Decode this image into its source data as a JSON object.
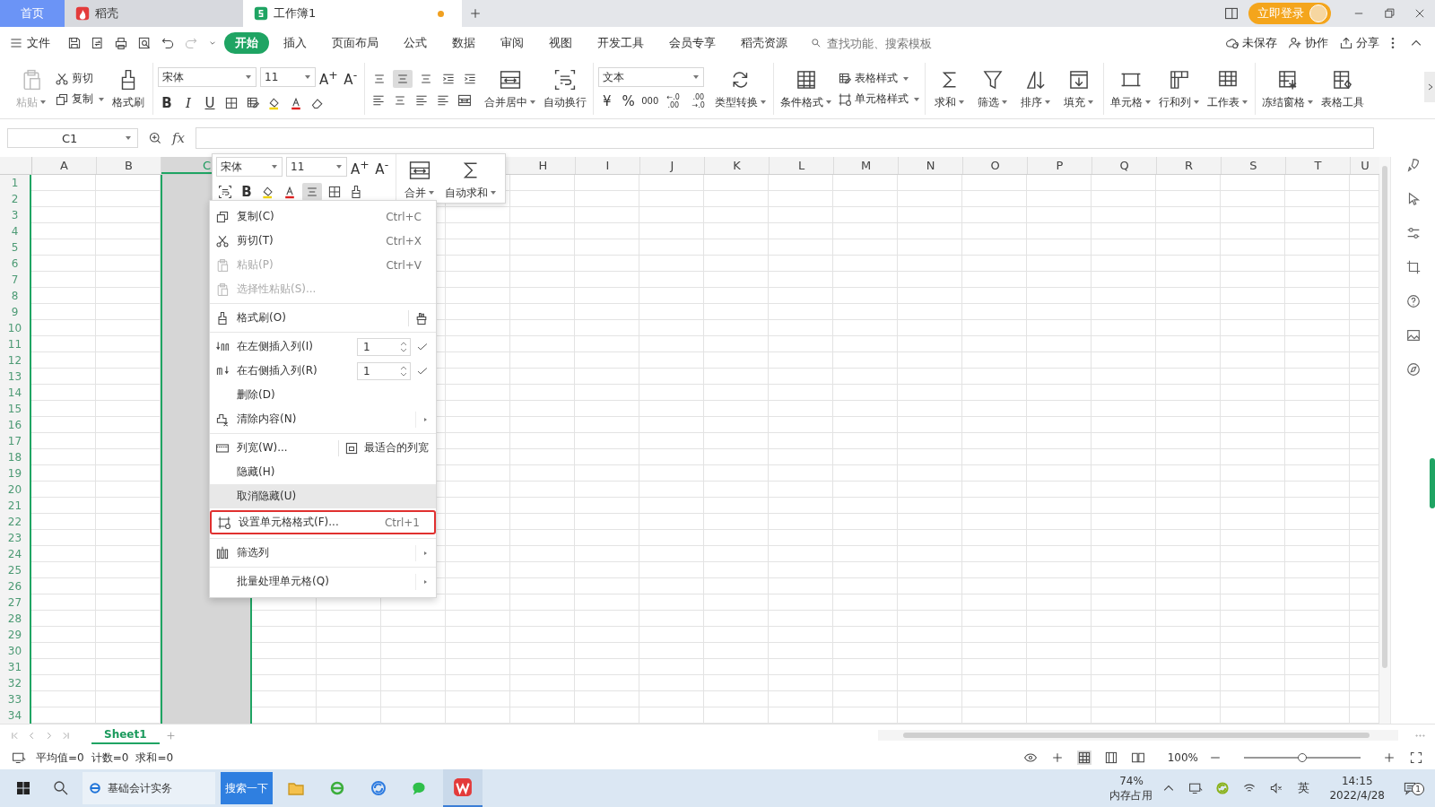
{
  "title_tabs": [
    {
      "label": "首页",
      "kind": "home",
      "selected": false,
      "modified": false
    },
    {
      "label": "稻壳",
      "kind": "docer",
      "selected": false,
      "modified": false
    },
    {
      "label": "工作簿1",
      "kind": "sheet",
      "selected": true,
      "modified": true
    }
  ],
  "login": "立即登录",
  "file_menu": "文件",
  "menu_tabs": [
    {
      "label": "开始",
      "selected": true
    },
    {
      "label": "插入",
      "selected": false
    },
    {
      "label": "页面布局",
      "selected": false
    },
    {
      "label": "公式",
      "selected": false
    },
    {
      "label": "数据",
      "selected": false
    },
    {
      "label": "审阅",
      "selected": false
    },
    {
      "label": "视图",
      "selected": false
    },
    {
      "label": "开发工具",
      "selected": false
    },
    {
      "label": "会员专享",
      "selected": false
    },
    {
      "label": "稻壳资源",
      "selected": false
    }
  ],
  "search": {
    "placeholder": "查找功能、搜索模板"
  },
  "unsaved": "未保存",
  "collaborate": "协作",
  "share": "分享",
  "ribbon": {
    "paste": {
      "label": "粘贴",
      "disabled": true
    },
    "cut": "剪切",
    "copy": "复制",
    "format_painter": "格式刷",
    "font_family": "宋体",
    "font_size": "11",
    "grow": "A$^{+}$",
    "shrink": "A$^{-}$",
    "bold": "B",
    "italic": "I",
    "underline": "U",
    "vertical_align": [
      {
        "selected": false
      },
      {
        "selected": true
      },
      {
        "selected": false
      }
    ],
    "merge": "合并居中",
    "wrap": "自动换行",
    "number_format": "文本",
    "currency": "¥",
    "percent": "%",
    "thousands": "000",
    "add_decimal": "←.0 .00",
    "remove_decimal": ".00 →.0",
    "convert": "类型转换",
    "conditional": "条件格式",
    "table_style": "表格样式",
    "cell_style": "单元格样式",
    "sum": "求和",
    "filter": "筛选",
    "sort": "排序",
    "fill": "填充",
    "cells": "单元格",
    "rows_cols": "行和列",
    "worksheet": "工作表",
    "freeze": "冻结窗格",
    "table_tools": "表格工具"
  },
  "name_box": "C1",
  "fx": "fx",
  "columns": [
    {
      "label": "A",
      "selected": false
    },
    {
      "label": "B",
      "selected": false
    },
    {
      "label": "C",
      "selected": true
    },
    {
      "label": "H",
      "selected": false
    },
    {
      "label": "I",
      "selected": false
    },
    {
      "label": "J",
      "selected": false
    },
    {
      "label": "K",
      "selected": false
    },
    {
      "label": "L",
      "selected": false
    },
    {
      "label": "M",
      "selected": false
    },
    {
      "label": "N",
      "selected": false
    },
    {
      "label": "O",
      "selected": false
    },
    {
      "label": "P",
      "selected": false
    },
    {
      "label": "Q",
      "selected": false
    },
    {
      "label": "R",
      "selected": false
    },
    {
      "label": "S",
      "selected": false
    },
    {
      "label": "T",
      "selected": false
    },
    {
      "label": "U",
      "selected": false
    }
  ],
  "rows": [
    "1",
    "2",
    "3",
    "4",
    "5",
    "6",
    "7",
    "8",
    "9",
    "10",
    "11",
    "12",
    "13",
    "14",
    "15",
    "16",
    "17",
    "18",
    "19",
    "20",
    "21",
    "22",
    "23",
    "24",
    "25",
    "26",
    "27",
    "28",
    "29",
    "30",
    "31",
    "32",
    "33",
    "34"
  ],
  "mini_toolbar": {
    "font": "宋体",
    "size": "11",
    "grow": "A$^{+}$",
    "shrink": "A$^{-}$",
    "merge": "合并",
    "autosum": "自动求和",
    "bold": "B",
    "align_active": true
  },
  "context_menu": [
    [
      {
        "kind": "plain",
        "label": "复制(C)",
        "shortcut": "Ctrl+C",
        "disabled": false,
        "submenu": false,
        "selected": false,
        "outlined": false
      },
      {
        "kind": "plain",
        "label": "剪切(T)",
        "shortcut": "Ctrl+X",
        "disabled": false,
        "submenu": false,
        "selected": false,
        "outlined": false
      },
      {
        "kind": "plain",
        "label": "粘贴(P)",
        "shortcut": "Ctrl+V",
        "disabled": true,
        "submenu": false,
        "selected": false,
        "outlined": false
      },
      {
        "kind": "plain",
        "label": "选择性粘贴(S)...",
        "disabled": true,
        "submenu": false,
        "selected": false,
        "outlined": false
      }
    ],
    [
      {
        "kind": "painter",
        "label": "格式刷(O)",
        "disabled": false,
        "submenu": false,
        "selected": false,
        "outlined": false
      }
    ],
    [
      {
        "kind": "spinner",
        "label": "在左侧插入列(I)",
        "value": "1",
        "disabled": false,
        "submenu": false,
        "selected": false,
        "outlined": false
      },
      {
        "kind": "spinner",
        "label": "在右侧插入列(R)",
        "value": "1",
        "disabled": false,
        "submenu": false,
        "selected": false,
        "outlined": false
      },
      {
        "kind": "plain",
        "label": "删除(D)",
        "disabled": false,
        "submenu": false,
        "selected": false,
        "outlined": false
      },
      {
        "kind": "plain",
        "label": "清除内容(N)",
        "disabled": false,
        "submenu": true,
        "selected": false,
        "outlined": false
      }
    ],
    [
      {
        "kind": "split",
        "label": "列宽(W)...",
        "aside": "最适合的列宽",
        "disabled": false,
        "submenu": false,
        "selected": false,
        "outlined": false
      },
      {
        "kind": "plain",
        "label": "隐藏(H)",
        "disabled": false,
        "submenu": false,
        "selected": false,
        "outlined": false
      },
      {
        "kind": "plain",
        "label": "取消隐藏(U)",
        "disabled": false,
        "submenu": false,
        "selected": true,
        "outlined": false
      },
      {
        "kind": "plain",
        "label": "设置单元格格式(F)...",
        "shortcut": "Ctrl+1",
        "disabled": false,
        "submenu": false,
        "selected": false,
        "outlined": true
      }
    ],
    [
      {
        "kind": "plain",
        "label": "筛选列",
        "disabled": false,
        "submenu": true,
        "selected": false,
        "outlined": false
      }
    ],
    [
      {
        "kind": "plain",
        "label": "批量处理单元格(Q)",
        "disabled": false,
        "submenu": true,
        "selected": false,
        "outlined": false
      }
    ]
  ],
  "sheet_tabs": [
    {
      "label": "Sheet1",
      "selected": true
    }
  ],
  "status": [
    "平均值=0",
    "计数=0",
    "求和=0"
  ],
  "zoom": {
    "reading": "100%",
    "level": 0.5
  },
  "taskbar": {
    "search_value": "基础会计实务",
    "search_button": "搜索一下",
    "memory": "74%",
    "memory_label": "内存占用",
    "ime": "英",
    "time": "14:15",
    "date": "2022/4/28",
    "notifications": "1"
  }
}
